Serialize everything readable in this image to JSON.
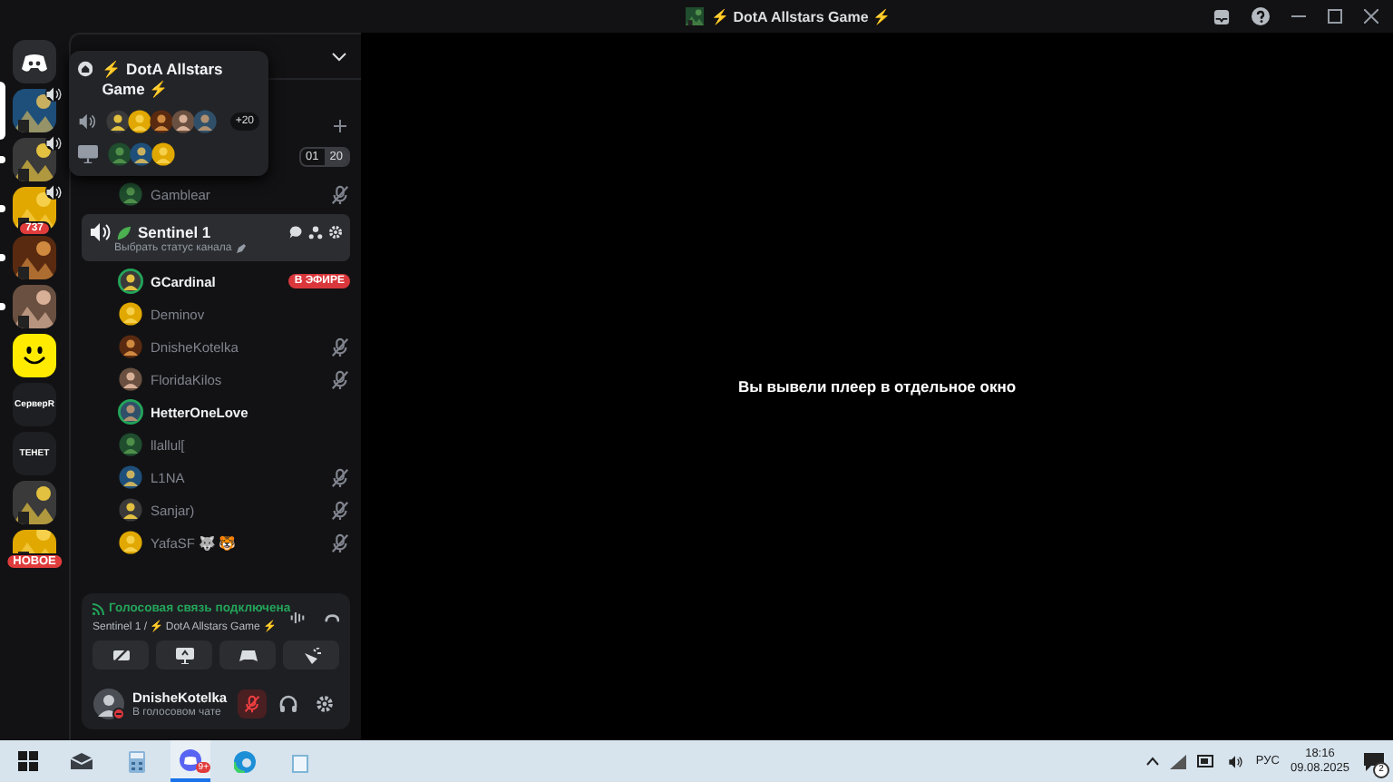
{
  "titlebar": {
    "title": "⚡ DotA Allstars Game ⚡"
  },
  "servers": [
    {
      "kind": "home",
      "selected": false,
      "unread": false,
      "voice": false
    },
    {
      "kind": "picture",
      "selected": true,
      "unread": false,
      "voice": true
    },
    {
      "kind": "picture",
      "selected": false,
      "unread": true,
      "voice": true
    },
    {
      "kind": "picture",
      "selected": false,
      "unread": true,
      "voice": true,
      "badge": "737"
    },
    {
      "kind": "picture",
      "selected": false,
      "unread": true,
      "voice": false
    },
    {
      "kind": "picture",
      "selected": false,
      "unread": true,
      "voice": false
    },
    {
      "kind": "smiley",
      "selected": false,
      "unread": false,
      "voice": false
    },
    {
      "kind": "text",
      "label": "СерверR",
      "selected": false,
      "unread": false,
      "voice": false
    },
    {
      "kind": "text",
      "label": "ТЕНЕТ",
      "selected": false,
      "unread": false,
      "voice": false
    },
    {
      "kind": "picture",
      "selected": false,
      "unread": false,
      "voice": false
    },
    {
      "kind": "picture",
      "selected": false,
      "unread": false,
      "voice": false,
      "badge": "НОВОЕ"
    }
  ],
  "popup": {
    "title": "⚡ DotA Allstars Game ⚡",
    "voice_more": "+20"
  },
  "channels": {
    "limit_current": "01",
    "limit_max": "20",
    "members_above": [
      {
        "name": "Gamblear",
        "speaking": false,
        "muted": true
      }
    ],
    "active": {
      "name": "Sentinel 1",
      "status": "Выбрать статус канала",
      "selected": true
    },
    "members": [
      {
        "name": "GCardinal",
        "speaking": true,
        "muted": false,
        "live": "В ЭФИРЕ"
      },
      {
        "name": "Deminov",
        "speaking": false,
        "muted": false
      },
      {
        "name": "DnisheKotelka",
        "speaking": false,
        "muted": true
      },
      {
        "name": "FloridaKilos",
        "speaking": false,
        "muted": true
      },
      {
        "name": "HetterOneLove",
        "speaking": true,
        "muted": false
      },
      {
        "name": "llallul[",
        "speaking": false,
        "muted": false
      },
      {
        "name": "L1NA",
        "speaking": false,
        "muted": true
      },
      {
        "name": "Sanjar)",
        "speaking": false,
        "muted": true
      },
      {
        "name": "YafaSF 🐺 🐯",
        "speaking": false,
        "muted": true
      }
    ]
  },
  "voice_panel": {
    "status": "Голосовая связь подключена",
    "location": "Sentinel 1 / ⚡ DotA Allstars Game ⚡"
  },
  "user": {
    "name": "DnisheKotelka",
    "activity": "В голосовом чате",
    "mic_muted": true
  },
  "content": {
    "message": "Вы вывели плеер в отдельное окно"
  },
  "taskbar": {
    "discord_badge": "9+",
    "language": "РУС",
    "time": "18:16",
    "date": "09.08.2025",
    "notifications": "2"
  }
}
